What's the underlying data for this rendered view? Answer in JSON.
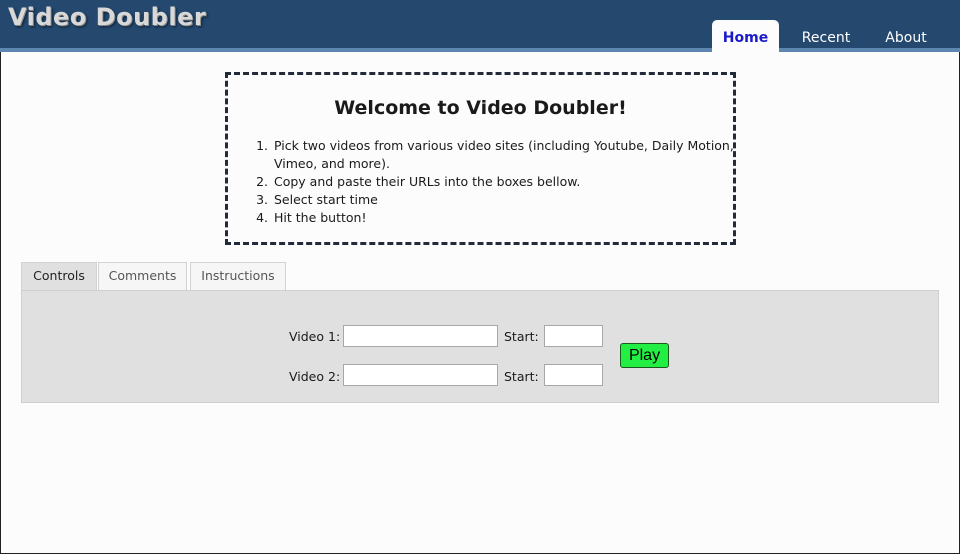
{
  "app": {
    "logo": "Video Doubler"
  },
  "nav": {
    "items": [
      "Home",
      "Recent",
      "About"
    ],
    "active": "Home"
  },
  "welcome": {
    "title": "Welcome to Video Doubler!",
    "steps": [
      "Pick two videos from various video sites (including Youtube, Daily Motion, Vimeo, and more).",
      "Copy and paste their URLs into the boxes bellow.",
      "Select start time",
      "Hit the button!"
    ]
  },
  "tabs": {
    "items": [
      "Controls",
      "Comments",
      "Instructions"
    ],
    "active": "Controls"
  },
  "controls": {
    "video1": {
      "label": "Video 1:",
      "value": "",
      "start_label": "Start:",
      "start_value": ""
    },
    "video2": {
      "label": "Video 2:",
      "value": "",
      "start_label": "Start:",
      "start_value": ""
    },
    "play_label": "Play"
  },
  "colors": {
    "header_bg": "#24486e",
    "header_stripe": "#5d86b0",
    "nav_active_text": "#1a1acc",
    "play_button": "#22ee44",
    "panel_bg": "#e0e0e0"
  }
}
